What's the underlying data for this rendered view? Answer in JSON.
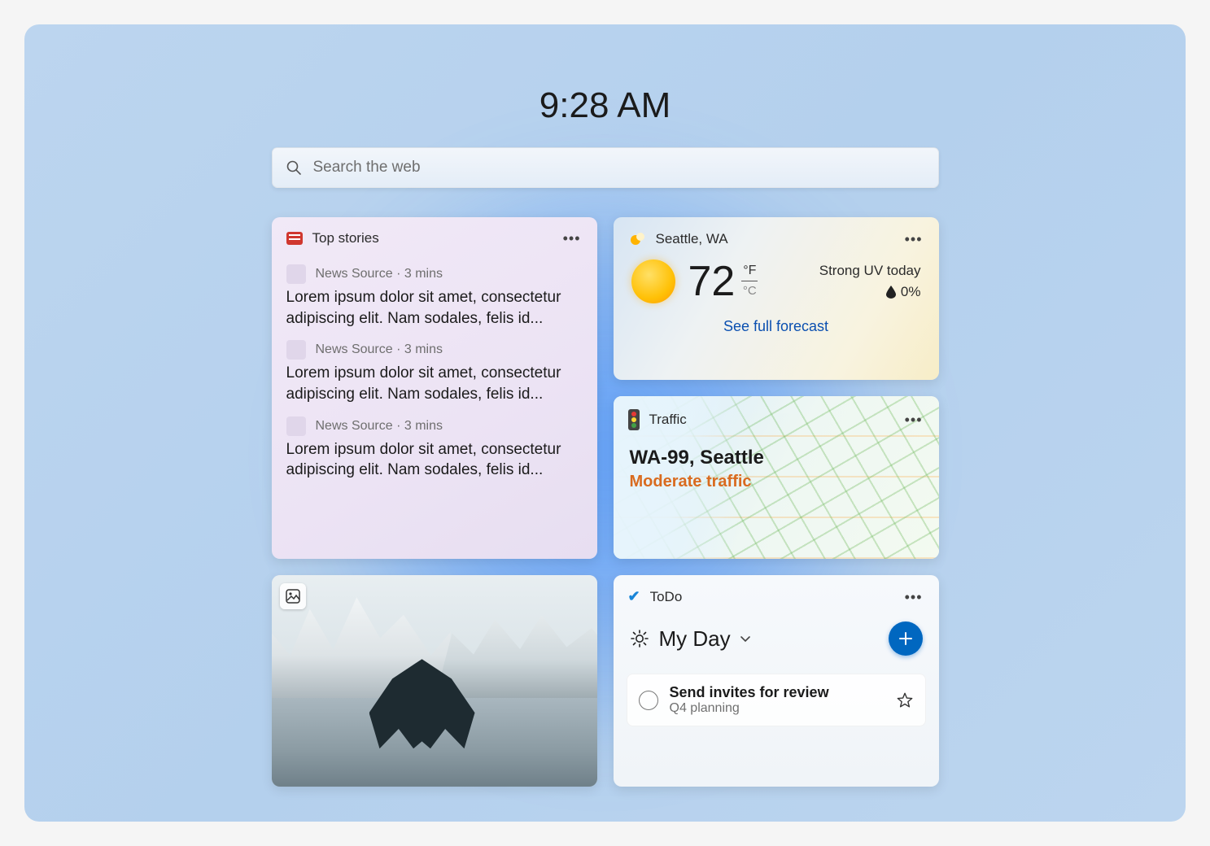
{
  "clock": "9:28 AM",
  "search": {
    "placeholder": "Search the web"
  },
  "news": {
    "title": "Top stories",
    "items": [
      {
        "source": "News Source",
        "age": "3 mins",
        "headline": "Lorem ipsum dolor sit amet, consectetur adipiscing elit. Nam sodales, felis id..."
      },
      {
        "source": "News Source",
        "age": "3 mins",
        "headline": "Lorem ipsum dolor sit amet, consectetur adipiscing elit. Nam sodales, felis id..."
      },
      {
        "source": "News Source",
        "age": "3 mins",
        "headline": "Lorem ipsum dolor sit amet, consectetur adipiscing elit. Nam sodales, felis id..."
      }
    ]
  },
  "weather": {
    "location": "Seattle, WA",
    "temp": "72",
    "unit_primary": "°F",
    "unit_secondary": "°C",
    "alert": "Strong UV today",
    "precip": "0%",
    "link": "See full forecast"
  },
  "traffic": {
    "title": "Traffic",
    "route": "WA-99, Seattle",
    "status": "Moderate traffic"
  },
  "todo": {
    "title": "ToDo",
    "list": "My Day",
    "task_name": "Send invites for review",
    "task_sub": "Q4 planning"
  }
}
